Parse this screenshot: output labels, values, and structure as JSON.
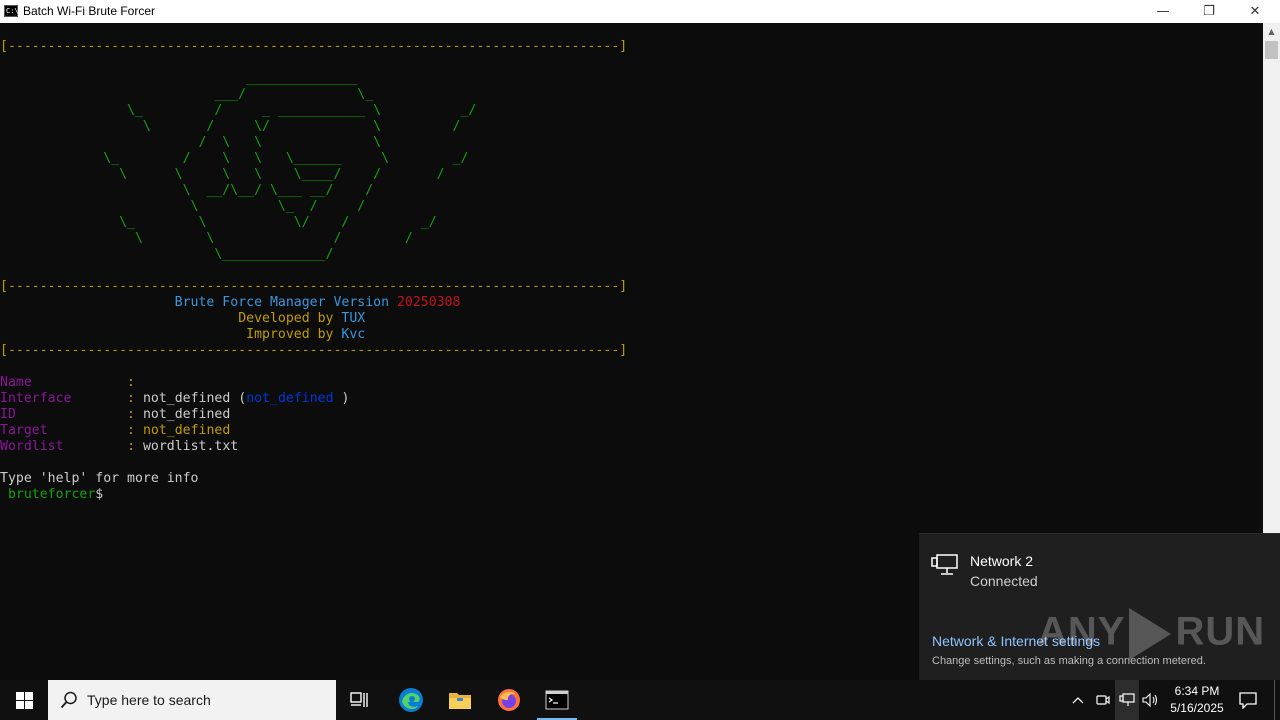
{
  "window": {
    "title": "Batch Wi-Fi Brute Forcer",
    "app_icon_text": "C:\\",
    "minimize_glyph": "—",
    "maximize_glyph": "❐",
    "close_glyph": "✕"
  },
  "console": {
    "separator": "[-----------------------------------------------------------------------------]",
    "ascii_art": [
      "",
      "                               ______________",
      "                           ___/              \\_",
      "                \\_         /     _ ___________ \\          _/",
      "                  \\       /     \\/             \\         /",
      "                         /  \\   \\              \\",
      "             \\_        /    \\   \\   \\______     \\        _/",
      "               \\      \\     \\   \\    \\____/    /       /",
      "                       \\  __/\\__/ \\___ __/    /",
      "                        \\          \\_  /     /",
      "               \\_        \\           \\/    /         _/",
      "                 \\        \\               /        /",
      "                           \\_____________/",
      ""
    ],
    "header": {
      "title_prefix": "Brute Force Manager Version ",
      "version": "20250308",
      "developed_prefix": "Developed by ",
      "developer": "TUX",
      "improved_prefix": "Improved by ",
      "improver": "Kvc"
    },
    "fields": {
      "name_label": "Name",
      "interface_label": "Interface",
      "interface_value": "not_defined",
      "interface_paren_open": " (",
      "interface_sub": "not_defined",
      "interface_paren_close": " )",
      "id_label": "ID",
      "id_value": "not_defined",
      "target_label": "Target",
      "target_value": "not_defined",
      "wordlist_label": "Wordlist",
      "wordlist_value": "wordlist.txt",
      "colon": ":"
    },
    "help_text": "Type 'help' for more info",
    "prompt_name": " bruteforcer",
    "prompt_symbol": "$"
  },
  "network_flyout": {
    "network_name": "Network 2",
    "status": "Connected",
    "settings_link": "Network & Internet settings",
    "settings_desc": "Change settings, such as making a connection metered."
  },
  "watermark": {
    "left": "ANY",
    "right": "RUN"
  },
  "taskbar": {
    "search_placeholder": "Type here to search",
    "time": "6:34 PM",
    "date": "5/16/2025"
  },
  "colors": {
    "console_bg": "#0c0c0c",
    "green": "#13a10e",
    "yellow": "#c19c00",
    "cyan": "#3a96dd",
    "red": "#c50f1f",
    "magenta": "#881798",
    "blue": "#0037da",
    "taskbar_bg": "#101010",
    "flyout_bg": "#1f1f1f"
  }
}
